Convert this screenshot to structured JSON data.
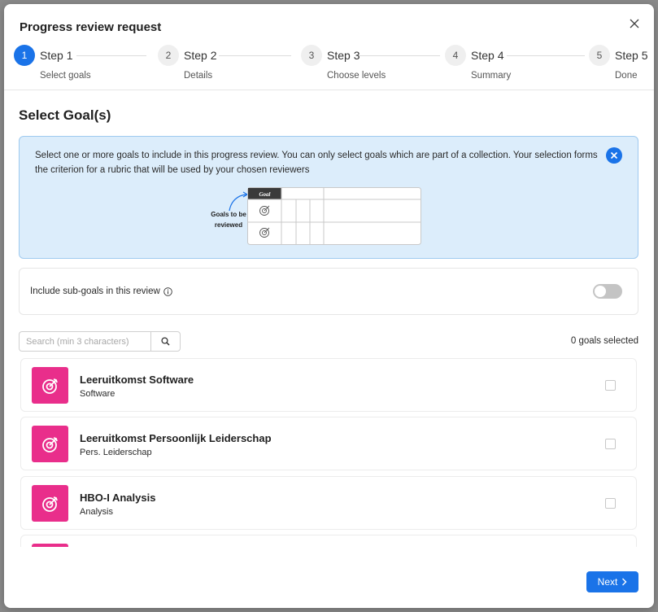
{
  "modal": {
    "title": "Progress review request"
  },
  "steps": [
    {
      "number": "1",
      "name": "Step 1",
      "sub": "Select goals"
    },
    {
      "number": "2",
      "name": "Step 2",
      "sub": "Details"
    },
    {
      "number": "3",
      "name": "Step 3",
      "sub": "Choose levels"
    },
    {
      "number": "4",
      "name": "Step 4",
      "sub": "Summary"
    },
    {
      "number": "5",
      "name": "Step 5",
      "sub": "Done"
    }
  ],
  "active_step": 1,
  "section": {
    "title": "Select Goal(s)"
  },
  "info": {
    "text": "Select one or more goals to include in this progress review. You can only select goals which are part of a collection. Your selection forms the criterion for a rubric that will be used by your chosen reviewers",
    "illustration_label": "Goals to be reviewed",
    "illustration_header": "Goal"
  },
  "subgoals": {
    "label": "Include sub-goals in this review",
    "enabled": false
  },
  "search": {
    "placeholder": "Search (min 3 characters)",
    "value": ""
  },
  "goals_count": "0 goals selected",
  "goals": [
    {
      "title": "Leeruitkomst Software",
      "subtitle": "Software"
    },
    {
      "title": "Leeruitkomst Persoonlijk Leiderschap",
      "subtitle": "Pers. Leiderschap"
    },
    {
      "title": "HBO-I Analysis",
      "subtitle": "Analysis"
    }
  ],
  "colors": {
    "accent": "#1a73e8",
    "goal_icon": "#e92e8b",
    "info_bg": "#dcedfb"
  },
  "icons": {
    "close": "close-icon",
    "search": "search-icon",
    "info": "info-icon",
    "goal": "target-icon",
    "next": "chevron-right-icon"
  },
  "footer": {
    "next_label": "Next"
  }
}
